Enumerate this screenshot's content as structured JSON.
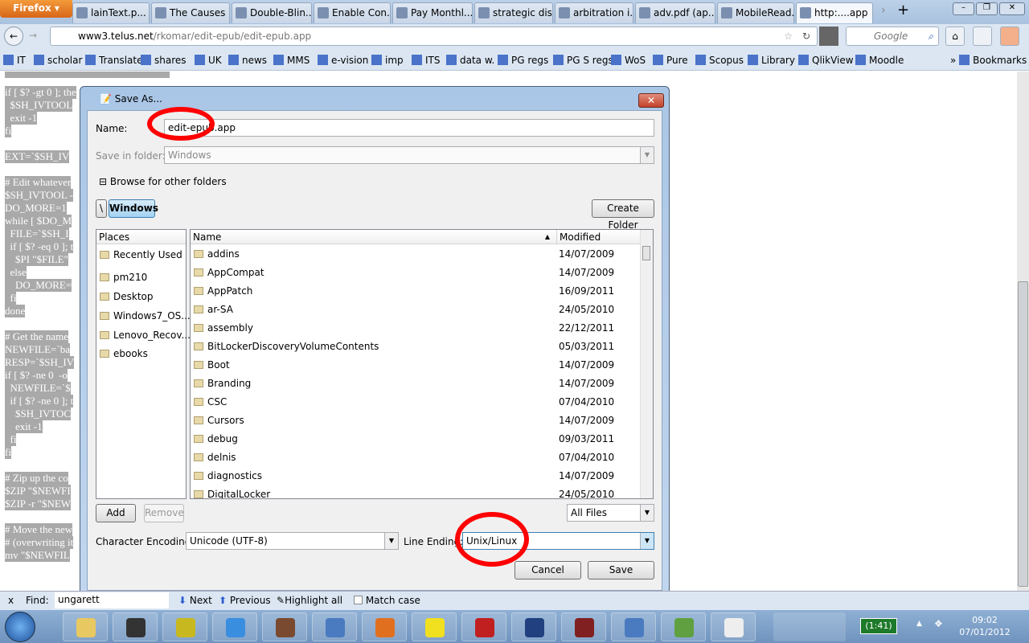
{
  "browser": {
    "menu_button": "Firefox",
    "tabs": [
      {
        "label": "lainText.p...",
        "active": false
      },
      {
        "label": "The Causes ...",
        "active": false
      },
      {
        "label": "Double-Blin...",
        "active": false
      },
      {
        "label": "Enable Con...",
        "active": false
      },
      {
        "label": "Pay Monthl...",
        "active": false
      },
      {
        "label": "strategic dis...",
        "active": false
      },
      {
        "label": "arbitration i...",
        "active": false
      },
      {
        "label": "adv.pdf (ap...",
        "active": false
      },
      {
        "label": "MobileRead...",
        "active": false
      },
      {
        "label": "http:....app",
        "active": true
      }
    ],
    "url_host": "www3.telus.net",
    "url_path": "/rkomar/edit-epub/edit-epub.app",
    "search_placeholder": "Google",
    "bookmarks": [
      "IT",
      "scholar",
      "Translate",
      "shares",
      "UK",
      "news",
      "MMS",
      "e-vision",
      "imp",
      "ITS",
      "data w.",
      "PG regs",
      "PG S regs",
      "WoS",
      "Pure",
      "Scopus",
      "Library",
      "QlikView",
      "Moodle"
    ],
    "bookmarks_menu": "Bookmarks"
  },
  "page": {
    "code_lines": [
      {
        "t": "if [ $? -gt 0 ]; the",
        "y": 0
      },
      {
        "t": "  $SH_IVTOOL",
        "y": 1
      },
      {
        "t": "  exit -1",
        "y": 2
      },
      {
        "t": "fi",
        "y": 3
      },
      {
        "t": "EXT=`$SH_IV",
        "y": 5
      },
      {
        "t": "# Edit whatever",
        "y": 7
      },
      {
        "t": "$SH_IVTOOL -",
        "y": 8
      },
      {
        "t": "DO_MORE=1",
        "y": 9
      },
      {
        "t": "while [ $DO_M",
        "y": 10
      },
      {
        "t": "  FILE=`$SH_I",
        "y": 11
      },
      {
        "t": "  if [ $? -eq 0 ]; t",
        "y": 12
      },
      {
        "t": "    $PI \"$FILE\"",
        "y": 13
      },
      {
        "t": "  else",
        "y": 14
      },
      {
        "t": "    DO_MORE=",
        "y": 15
      },
      {
        "t": "  fi",
        "y": 16
      },
      {
        "t": "done",
        "y": 17
      },
      {
        "t": "# Get the name",
        "y": 19
      },
      {
        "t": "NEWFILE=`ba",
        "y": 20
      },
      {
        "t": "RESP=`$SH_IV",
        "y": 21
      },
      {
        "t": "if [ $? -ne 0  -o",
        "y": 22
      },
      {
        "t": "  NEWFILE=`$",
        "y": 23
      },
      {
        "t": "  if [ $? -ne 0 ]; t",
        "y": 24
      },
      {
        "t": "    $SH_IVTOC",
        "y": 25
      },
      {
        "t": "    exit -1",
        "y": 26
      },
      {
        "t": "  fi",
        "y": 27
      },
      {
        "t": "fi",
        "y": 28
      },
      {
        "t": "# Zip up the co",
        "y": 30
      },
      {
        "t": "$ZIP \"$NEWFI",
        "y": 31
      },
      {
        "t": "$ZIP -r \"$NEW",
        "y": 32
      },
      {
        "t": "# Move the new",
        "y": 34
      },
      {
        "t": "# (overwriting it",
        "y": 35
      },
      {
        "t": "mv \"$NEWFIL",
        "y": 36
      }
    ]
  },
  "dialog": {
    "title": "Save As...",
    "name_label": "Name:",
    "name_value": "edit-epub.app",
    "save_in_label": "Save in folder:",
    "save_in_value": "Windows",
    "browse_label": "Browse for other folders",
    "path_root": "\\",
    "path_current": "Windows",
    "create_folder": "Create Folder",
    "places_header": "Places",
    "places": [
      "Recently Used",
      "pm210",
      "Desktop",
      "Windows7_OS...",
      "Lenovo_Recov...",
      "ebooks"
    ],
    "columns": {
      "name": "Name",
      "modified": "Modified"
    },
    "files": [
      {
        "name": "addins",
        "date": "14/07/2009"
      },
      {
        "name": "AppCompat",
        "date": "14/07/2009"
      },
      {
        "name": "AppPatch",
        "date": "16/09/2011"
      },
      {
        "name": "ar-SA",
        "date": "24/05/2010"
      },
      {
        "name": "assembly",
        "date": "22/12/2011"
      },
      {
        "name": "BitLockerDiscoveryVolumeContents",
        "date": "05/03/2011"
      },
      {
        "name": "Boot",
        "date": "14/07/2009"
      },
      {
        "name": "Branding",
        "date": "14/07/2009"
      },
      {
        "name": "CSC",
        "date": "07/04/2010"
      },
      {
        "name": "Cursors",
        "date": "14/07/2009"
      },
      {
        "name": "debug",
        "date": "09/03/2011"
      },
      {
        "name": "delnis",
        "date": "07/04/2010"
      },
      {
        "name": "diagnostics",
        "date": "14/07/2009"
      },
      {
        "name": "DigitalLocker",
        "date": "24/05/2010"
      }
    ],
    "add": "Add",
    "remove": "Remove",
    "filter": "All Files",
    "encoding_label": "Character Encoding:",
    "encoding_value": "Unicode (UTF-8)",
    "line_ending_label": "Line Ending:",
    "line_ending_value": "Unix/Linux",
    "cancel": "Cancel",
    "save": "Save"
  },
  "findbar": {
    "close": "x",
    "label": "Find:",
    "value": "ungarett",
    "next": "Next",
    "previous": "Previous",
    "highlight": "Highlight all",
    "match_case": "Match case"
  },
  "taskbar": {
    "battery": "(1:41)",
    "time": "09:02",
    "date": "07/01/2012"
  },
  "colors": {
    "annotation": "#ff0000",
    "code_highlight": "#a9a9a9"
  }
}
